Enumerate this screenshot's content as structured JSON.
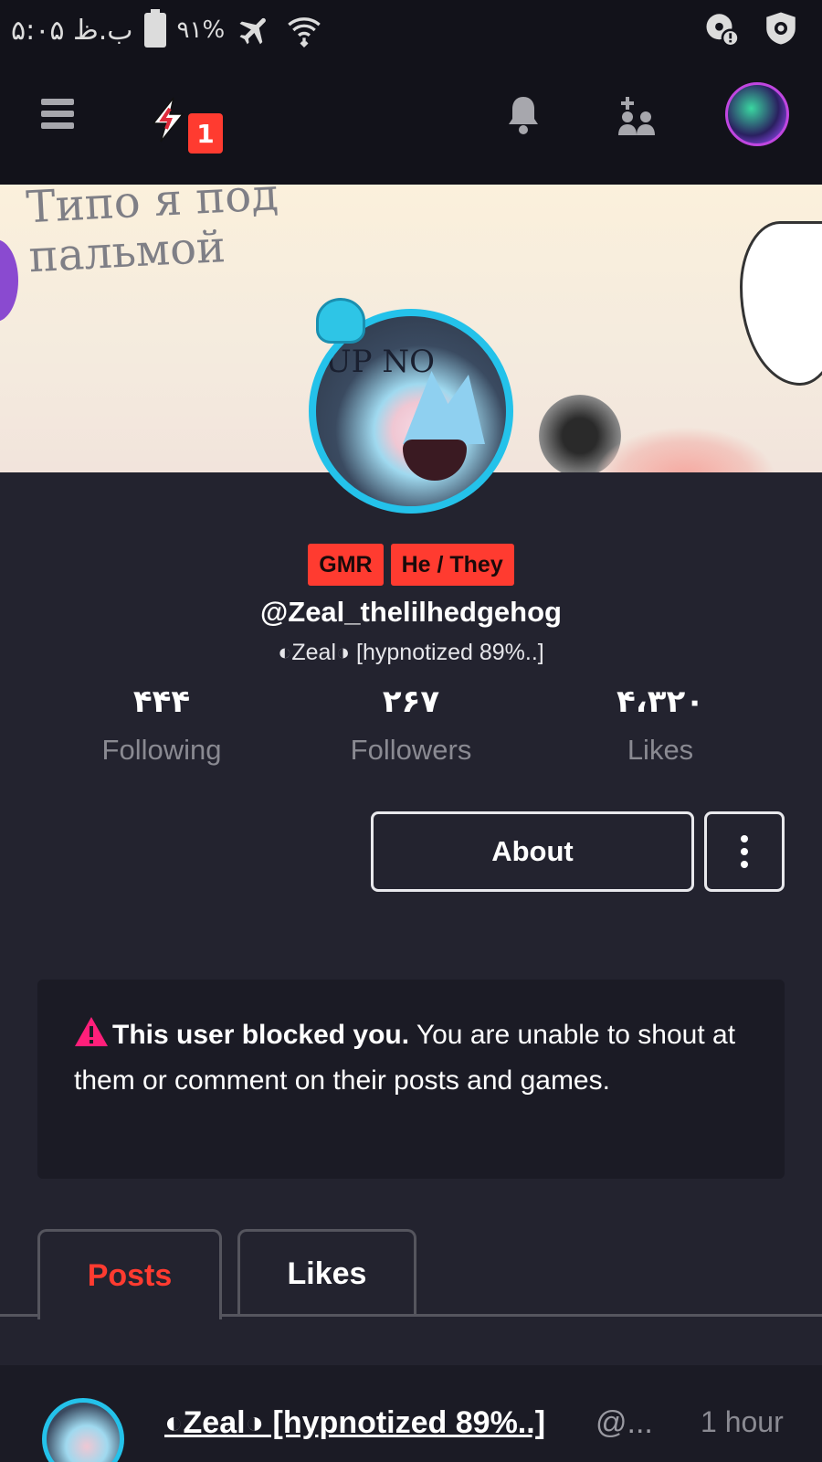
{
  "status_bar": {
    "time": "۵:۰۵ ب.ظ",
    "battery": "۹۱%"
  },
  "nav": {
    "notification_badge": "1"
  },
  "banner": {
    "scribble_text": "Типо я под пальмой"
  },
  "avatar_scribble": "UP NO",
  "profile": {
    "tags": [
      "GMR",
      "He / They"
    ],
    "username": "@Zeal_thelilhedgehog",
    "display_name": "◐Zeal◑ [hypnotized 89%..]",
    "stats": {
      "following": {
        "value": "۴۴۴",
        "label": "Following"
      },
      "followers": {
        "value": "۲۶۷",
        "label": "Followers"
      },
      "likes": {
        "value": "۴،۳۲۰",
        "label": "Likes"
      }
    },
    "about_label": "About"
  },
  "notice": {
    "bold": "This user blocked you.",
    "text": " You are unable to shout at them or comment on their posts and games."
  },
  "tabs": {
    "posts": "Posts",
    "likes": "Likes"
  },
  "post": {
    "author": "◐Zeal◑ [hypnotized 89%..]",
    "handle": "@...",
    "time": "1 hour"
  },
  "colors": {
    "accent": "#ff3b30",
    "background": "#23232f",
    "avatar_ring": "#24c2ea"
  },
  "icons": [
    "menu-icon",
    "lightning-icon",
    "bell-icon",
    "add-friend-icon",
    "warning-icon",
    "more-vertical-icon",
    "airplane-icon",
    "wifi-icon",
    "shield-icon"
  ]
}
